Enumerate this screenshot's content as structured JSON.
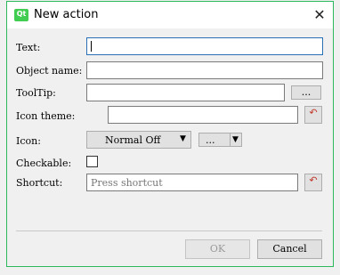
{
  "window": {
    "title": "New action",
    "app_icon_text": "Qt"
  },
  "fields": {
    "text_label": "Text:",
    "text_value": "",
    "object_name_label": "Object name:",
    "object_name_value": "",
    "tooltip_label": "ToolTip:",
    "tooltip_value": "",
    "tooltip_more": "...",
    "icon_theme_label": "Icon theme:",
    "icon_theme_value": "",
    "icon_label": "Icon:",
    "icon_state_selected": "Normal Off",
    "icon_more": "...",
    "checkable_label": "Checkable:",
    "checkable_checked": false,
    "shortcut_label": "Shortcut:",
    "shortcut_placeholder": "Press shortcut"
  },
  "buttons": {
    "ok": "OK",
    "cancel": "Cancel"
  }
}
